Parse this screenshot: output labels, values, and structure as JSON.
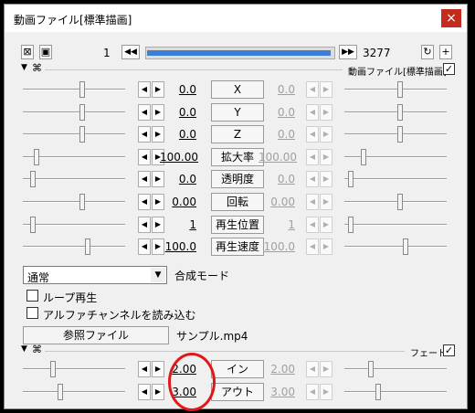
{
  "window": {
    "title": "動画ファイル[標準描画]",
    "close": "×"
  },
  "toolbar": {
    "frame_start": "1",
    "frame_end": "3277",
    "seek_progress": 0.985,
    "prev_symbol": "◀◀",
    "next_symbol": "▶▶",
    "add_symbol": "+"
  },
  "header": {
    "object_label": "動画ファイル[標準描画]",
    "checked": "✓"
  },
  "params": [
    {
      "name": "X",
      "value": "0.0",
      "end_value": "0.0"
    },
    {
      "name": "Y",
      "value": "0.0",
      "end_value": "0.0"
    },
    {
      "name": "Z",
      "value": "0.0",
      "end_value": "0.0"
    },
    {
      "name": "拡大率",
      "value": "100.00",
      "end_value": "100.00"
    },
    {
      "name": "透明度",
      "value": "0.0",
      "end_value": "0.0"
    },
    {
      "name": "回転",
      "value": "0.00",
      "end_value": "0.00"
    },
    {
      "name": "再生位置",
      "value": "1",
      "end_value": "1"
    },
    {
      "name": "再生速度",
      "value": "100.0",
      "end_value": "100.0"
    }
  ],
  "blend": {
    "selected": "通常",
    "label": "合成モード"
  },
  "options": {
    "loop": "ループ再生",
    "alpha": "アルファチャンネルを読み込む"
  },
  "file": {
    "button": "参照ファイル",
    "name": "サンプル.mp4"
  },
  "fade": {
    "label": "フェード",
    "checked": "✓",
    "params": [
      {
        "name": "イン",
        "value": "2.00",
        "end_value": "2.00"
      },
      {
        "name": "アウト",
        "value": "3.00",
        "end_value": "3.00"
      }
    ]
  },
  "arrows": {
    "left": "◀",
    "right": "▶"
  },
  "colors": {
    "seek_fill": "#3c7fd8",
    "highlight_ring": "#e01818",
    "close_bg": "#c42b1c"
  }
}
